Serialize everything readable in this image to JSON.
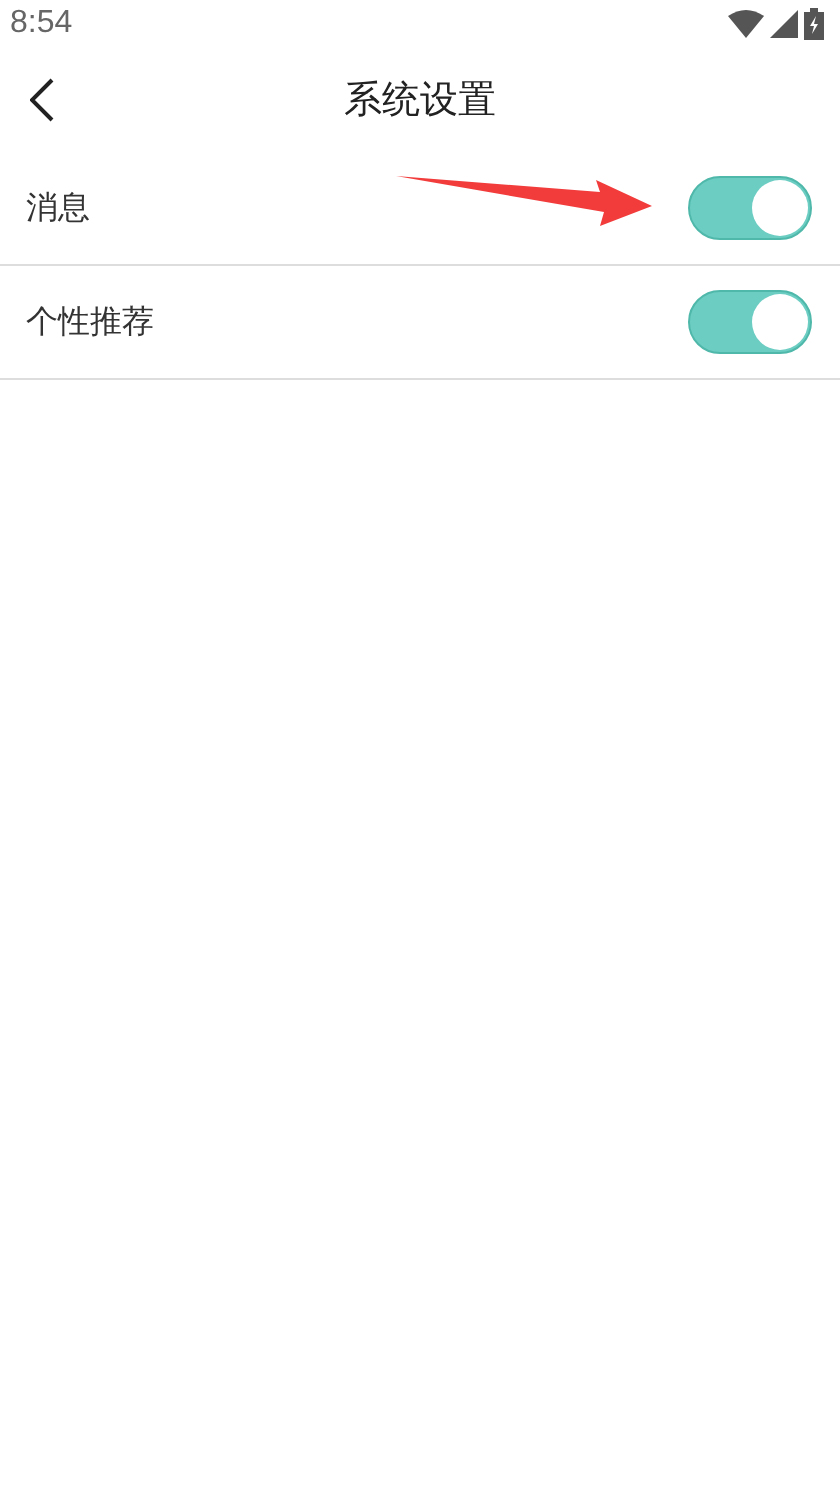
{
  "status_bar": {
    "time": "8:54"
  },
  "header": {
    "title": "系统设置"
  },
  "settings": [
    {
      "label": "消息",
      "on": true
    },
    {
      "label": "个性推荐",
      "on": true
    }
  ]
}
